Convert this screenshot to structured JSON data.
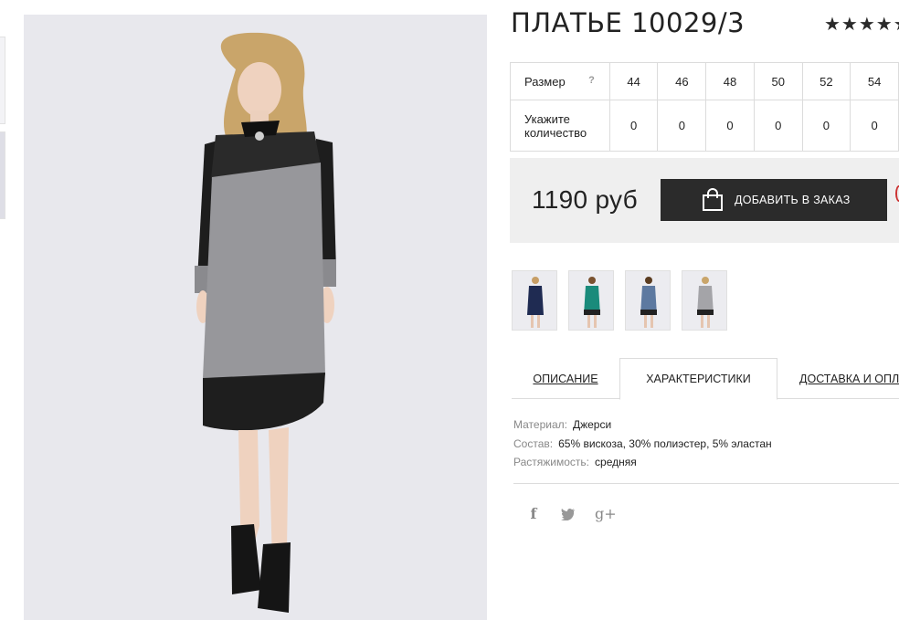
{
  "product": {
    "title": "ПЛАТЬЕ 10029/3",
    "rating_stars": "★★★★★"
  },
  "size_table": {
    "size_label": "Размер",
    "help_mark": "?",
    "sizes": [
      "44",
      "46",
      "48",
      "50",
      "52",
      "54"
    ],
    "qty_label": "Укажите количество",
    "quantities": [
      "0",
      "0",
      "0",
      "0",
      "0",
      "0"
    ]
  },
  "price": {
    "value": "1190 руб",
    "add_button_label": "ДОБАВИТЬ В ЗАКАЗ"
  },
  "tabs": [
    {
      "label": "ОПИСАНИЕ",
      "active": false
    },
    {
      "label": "ХАРАКТЕРИСТИКИ",
      "active": true
    },
    {
      "label": "ДОСТАВКА И ОПЛА",
      "active": false
    }
  ],
  "characteristics": [
    {
      "key": "Материал:",
      "value": "Джерси"
    },
    {
      "key": "Состав:",
      "value": "65% вискоза, 30% полиэстер, 5% эластан"
    },
    {
      "key": "Растяжимость:",
      "value": "средняя"
    }
  ],
  "social": {
    "facebook": "f",
    "twitter": "t",
    "google": "g+"
  },
  "colors": {
    "button_bg": "#2b2b2b",
    "price_bg": "#efefef"
  }
}
